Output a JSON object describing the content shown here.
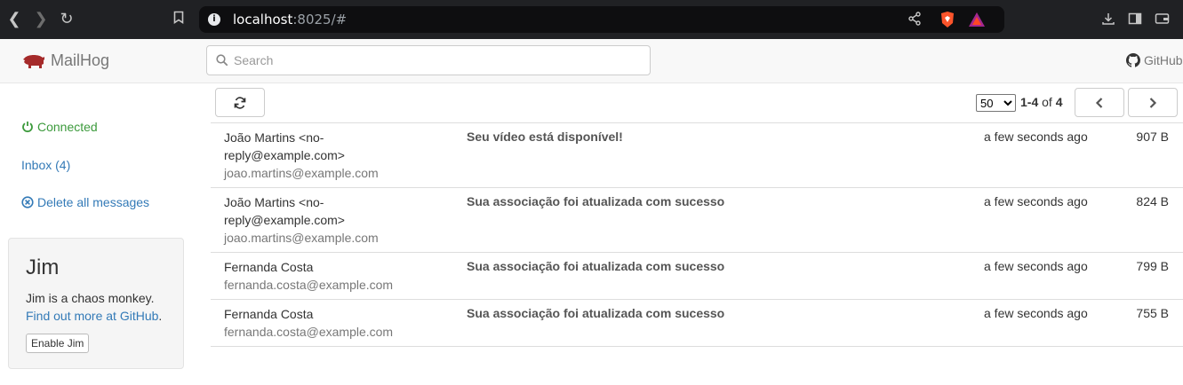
{
  "browser": {
    "url_host": "localhost",
    "url_rest": ":8025/#"
  },
  "header": {
    "brand": "MailHog",
    "search_placeholder": "Search",
    "github_label": "GitHub"
  },
  "sidebar": {
    "connected": "Connected",
    "inbox": "Inbox (4)",
    "delete_all": "Delete all messages"
  },
  "jim": {
    "title": "Jim",
    "text": "Jim is a chaos monkey.",
    "link": "Find out more at GitHub",
    "link_suffix": ".",
    "button": "Enable Jim"
  },
  "toolbar": {
    "per_page": "50",
    "range_start": "1-4",
    "of": "of",
    "total": "4"
  },
  "messages": [
    {
      "from_name": "João Martins <no-reply@example.com>",
      "from_addr": "joao.martins@example.com",
      "subject": "Seu vídeo está disponível!",
      "date": "a few seconds ago",
      "size": "907 B"
    },
    {
      "from_name": "João Martins <no-reply@example.com>",
      "from_addr": "joao.martins@example.com",
      "subject": "Sua associação foi atualizada com sucesso",
      "date": "a few seconds ago",
      "size": "824 B"
    },
    {
      "from_name": "Fernanda Costa",
      "from_addr": "fernanda.costa@example.com",
      "subject": "Sua associação foi atualizada com sucesso",
      "date": "a few seconds ago",
      "size": "799 B"
    },
    {
      "from_name": "Fernanda Costa",
      "from_addr": "fernanda.costa@example.com",
      "subject": "Sua associação foi atualizada com sucesso",
      "date": "a few seconds ago",
      "size": "755 B"
    }
  ]
}
